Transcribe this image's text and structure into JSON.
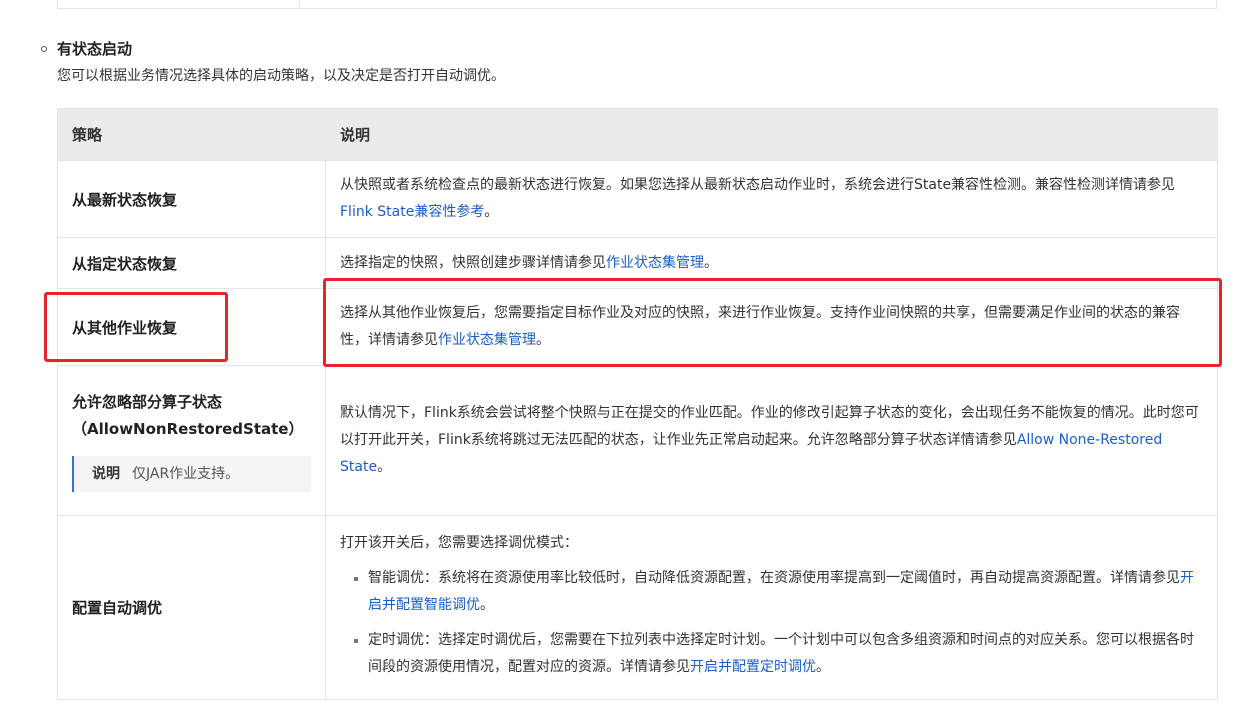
{
  "section": {
    "title": "有状态启动",
    "description": "您可以根据业务情况选择具体的启动策略，以及决定是否打开自动调优。"
  },
  "table": {
    "headers": {
      "strategy": "策略",
      "description": "说明"
    },
    "rows": [
      {
        "strategy": "从最新状态恢复",
        "desc_text": "从快照或者系统检查点的最新状态进行恢复。如果您选择从最新状态启动作业时，系统会进行State兼容性检测。兼容性检测详情请参见",
        "link": "Flink State兼容性参考",
        "desc_end": "。"
      },
      {
        "strategy": "从指定状态恢复",
        "desc_text": "选择指定的快照，快照创建步骤详情请参见",
        "link": "作业状态集管理",
        "desc_end": "。"
      },
      {
        "strategy": "从其他作业恢复",
        "desc_text": "选择从其他作业恢复后，您需要指定目标作业及对应的快照，来进行作业恢复。支持作业间快照的共享，但需要满足作业间的状态的兼容性，详情请参见",
        "link": "作业状态集管理",
        "desc_end": "。"
      },
      {
        "strategy": "允许忽略部分算子状态",
        "strategy_sub": "（AllowNonRestoredState）",
        "note_label": "说明",
        "note_text": "仅JAR作业支持。",
        "desc_text": "默认情况下，Flink系统会尝试将整个快照与正在提交的作业匹配。作业的修改引起算子状态的变化，会出现任务不能恢复的情况。此时您可以打开此开关，Flink系统将跳过无法匹配的状态，让作业先正常启动起来。允许忽略部分算子状态详情请参见",
        "link": "Allow None-Restored State",
        "desc_end": "。"
      },
      {
        "strategy": "配置自动调优",
        "desc_intro": "打开该开关后，您需要选择调优模式：",
        "bullets": [
          {
            "text": "智能调优：系统将在资源使用率比较低时，自动降低资源配置，在资源使用率提高到一定阈值时，再自动提高资源配置。详情请参见",
            "link": "开启并配置智能调优",
            "end": "。"
          },
          {
            "text": "定时调优：选择定时调优后，您需要在下拉列表中选择定时计划。一个计划中可以包含多组资源和时间点的对应关系。您可以根据各时间段的资源使用情况，配置对应的资源。详情请参见",
            "link": "开启并配置定时调优",
            "end": "。"
          }
        ]
      }
    ]
  },
  "colors": {
    "highlight": "#e8232b",
    "link": "#1a5ec9",
    "header_bg": "#ebebeb",
    "note_border": "#3b6fcf"
  }
}
